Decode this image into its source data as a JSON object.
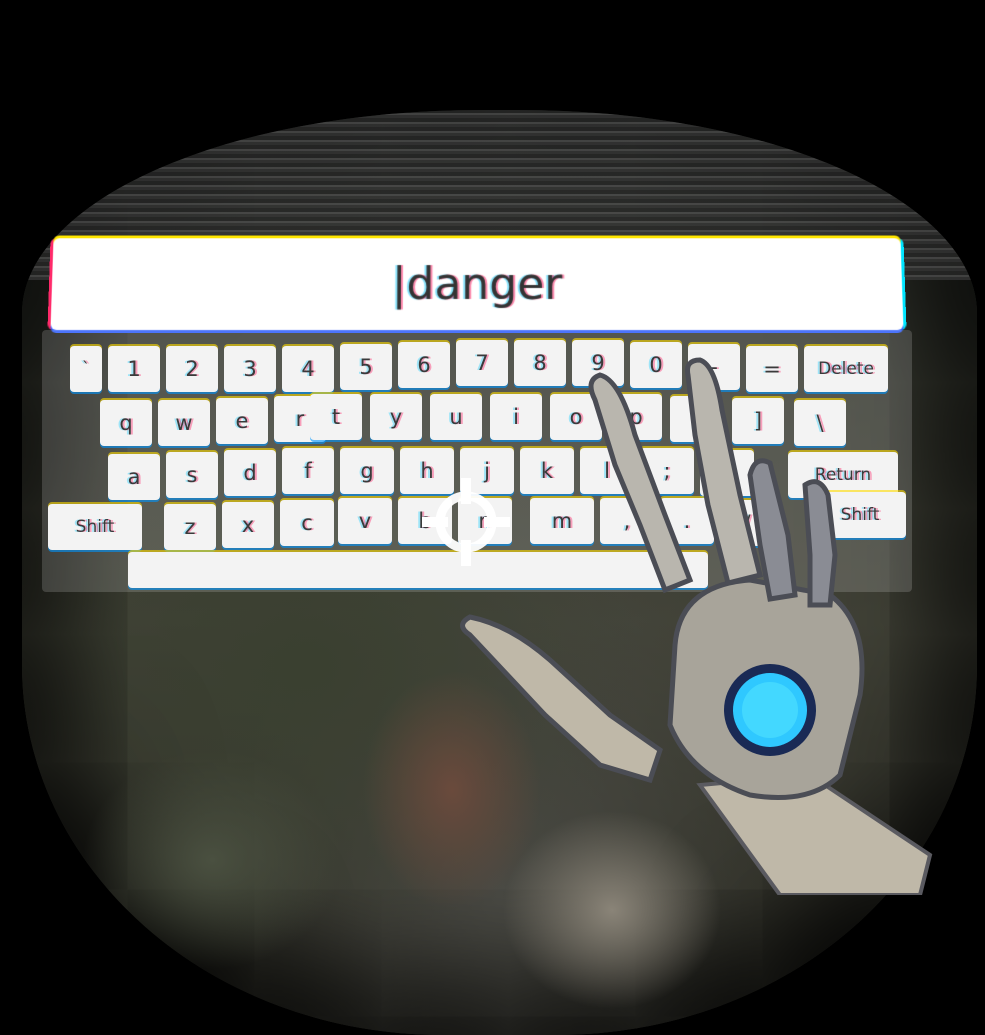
{
  "text_field": {
    "value": "|danger"
  },
  "keyboard": {
    "row_numbers": [
      "`",
      "1",
      "2",
      "3",
      "4",
      "5",
      "6",
      "7",
      "8",
      "9",
      "0",
      "-",
      "=",
      "Delete"
    ],
    "row_qwerty": [
      "q",
      "w",
      "e",
      "r",
      "t",
      "y",
      "u",
      "i",
      "o",
      "p",
      "[",
      "]",
      "\\"
    ],
    "row_home": [
      "a",
      "s",
      "d",
      "f",
      "g",
      "h",
      "j",
      "k",
      "l",
      ";",
      "'",
      "Return"
    ],
    "row_bottom": [
      "Shift",
      "z",
      "x",
      "c",
      "v",
      "b",
      "n",
      "m",
      ",",
      ".",
      "/",
      "Shift"
    ],
    "space_label": ""
  },
  "colors": {
    "keycap": "#f3f3f3",
    "key_text": "#3a3a3a",
    "field": "#ffffff",
    "palm_light": "#2fc8ff"
  },
  "icons": {
    "reticle": "crosshair-reticle-icon",
    "hand": "robot-hand-icon"
  }
}
